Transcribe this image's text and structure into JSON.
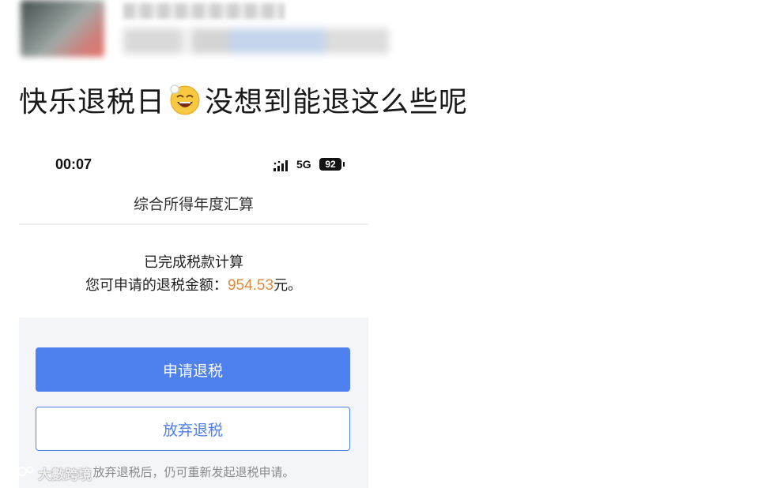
{
  "post": {
    "text_before": "快乐退税日",
    "emoji": "grinning-squint-face-emoji",
    "text_after": "没想到能退这么些呢"
  },
  "phone": {
    "status": {
      "time": "00:07",
      "network": "5G",
      "battery": "92"
    },
    "nav_title": "综合所得年度汇算",
    "result": {
      "line1": "已完成税款计算",
      "line2_prefix": "您可申请的退税金额：",
      "amount": "954.53",
      "line2_suffix": "元。"
    },
    "buttons": {
      "apply_label": "申请退税",
      "abandon_label": "放弃退税"
    },
    "hint": "放弃退税后，仍可重新发起退税申请。"
  },
  "watermark": {
    "text": "大數跨境"
  },
  "colors": {
    "primary": "#4e80ee",
    "amount": "#e08a3c",
    "grey_bg": "#f4f5f9"
  }
}
